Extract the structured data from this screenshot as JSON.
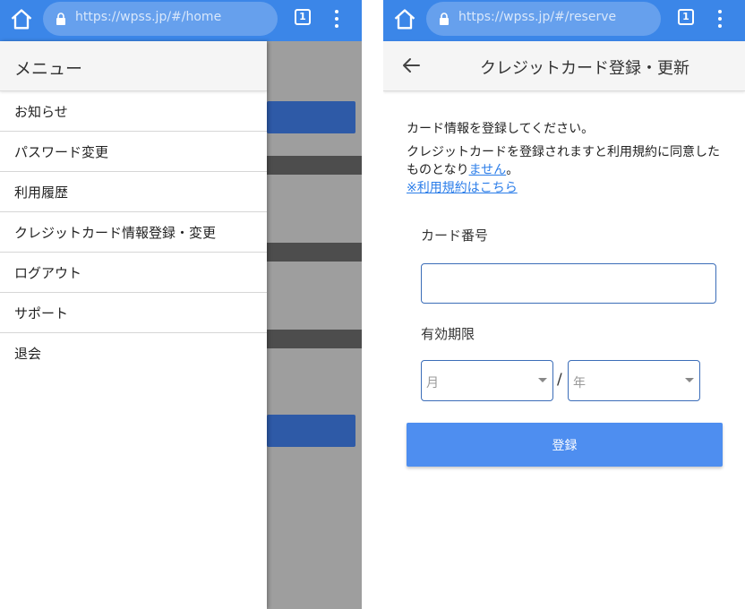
{
  "left_screen": {
    "browser": {
      "url": "https://wpss.jp/#/home",
      "tab_count": "1"
    },
    "drawer": {
      "title": "メニュー",
      "items": [
        {
          "label": "お知らせ"
        },
        {
          "label": "パスワード変更"
        },
        {
          "label": "利用履歴"
        },
        {
          "label": "クレジットカード情報登録・変更"
        },
        {
          "label": "ログアウト"
        },
        {
          "label": "サポート"
        },
        {
          "label": "退会"
        }
      ]
    }
  },
  "right_screen": {
    "browser": {
      "url": "https://wpss.jp/#/reserve",
      "tab_count": "1"
    },
    "appbar": {
      "title": "クレジットカード登録・更新"
    },
    "intro": {
      "line1": "カード情報を登録してください。",
      "line2_prefix": "クレジットカードを登録されますと利用規約に同意したものとなり",
      "line2_link": "ません",
      "line2_suffix": "。",
      "terms_link": "※利用規約はこちら"
    },
    "form": {
      "card_number_label": "カード番号",
      "card_number_value": "",
      "expiry_label": "有効期限",
      "month_placeholder": "月",
      "year_placeholder": "年",
      "separator": "/",
      "submit_label": "登録"
    }
  },
  "colors": {
    "browser_bar": "#3b86e8",
    "primary_button": "#4e8ef0",
    "link": "#2b7de9",
    "overlay": "#9e9e9e"
  }
}
